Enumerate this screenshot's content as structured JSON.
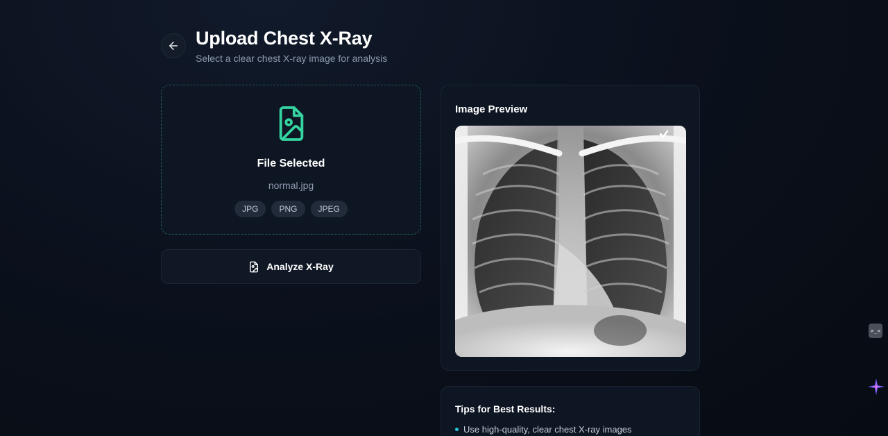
{
  "header": {
    "title": "Upload Chest X-Ray",
    "subtitle": "Select a clear chest X-ray image for analysis"
  },
  "upload": {
    "status": "File Selected",
    "file_name": "normal.jpg",
    "formats": [
      "JPG",
      "PNG",
      "JPEG"
    ]
  },
  "actions": {
    "analyze_label": "Analyze X-Ray"
  },
  "preview": {
    "title": "Image Preview"
  },
  "tips": {
    "title": "Tips for Best Results:",
    "items": [
      "Use high-quality, clear chest X-ray images"
    ]
  },
  "widgets": {
    "terminal_glyph": ">_<"
  },
  "icons": {
    "back": "arrow-left-icon",
    "file": "file-image-icon",
    "analyze": "file-scan-icon",
    "assistant": "sparkle-icon"
  },
  "colors": {
    "accent_green": "#34d3a0",
    "accent_cyan": "#23c6d9",
    "background": "#0b111d",
    "card": "#0e1623"
  }
}
